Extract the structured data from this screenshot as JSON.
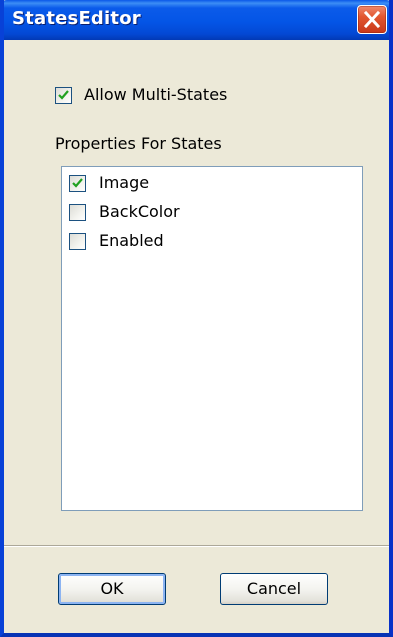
{
  "window": {
    "title": "StatesEditor",
    "close_icon": "close-icon"
  },
  "allow_multi_states": {
    "label": "Allow Multi-States",
    "checked": true
  },
  "properties": {
    "group_label": "Properties For States",
    "items": [
      {
        "label": "Image",
        "checked": true
      },
      {
        "label": "BackColor",
        "checked": false
      },
      {
        "label": "Enabled",
        "checked": false
      }
    ]
  },
  "buttons": {
    "ok_label": "OK",
    "cancel_label": "Cancel"
  },
  "colors": {
    "titlebar": "#0455E6",
    "dialog_bg": "#ECE9D8",
    "checkmark": "#21A121",
    "close_button": "#E2562F"
  }
}
